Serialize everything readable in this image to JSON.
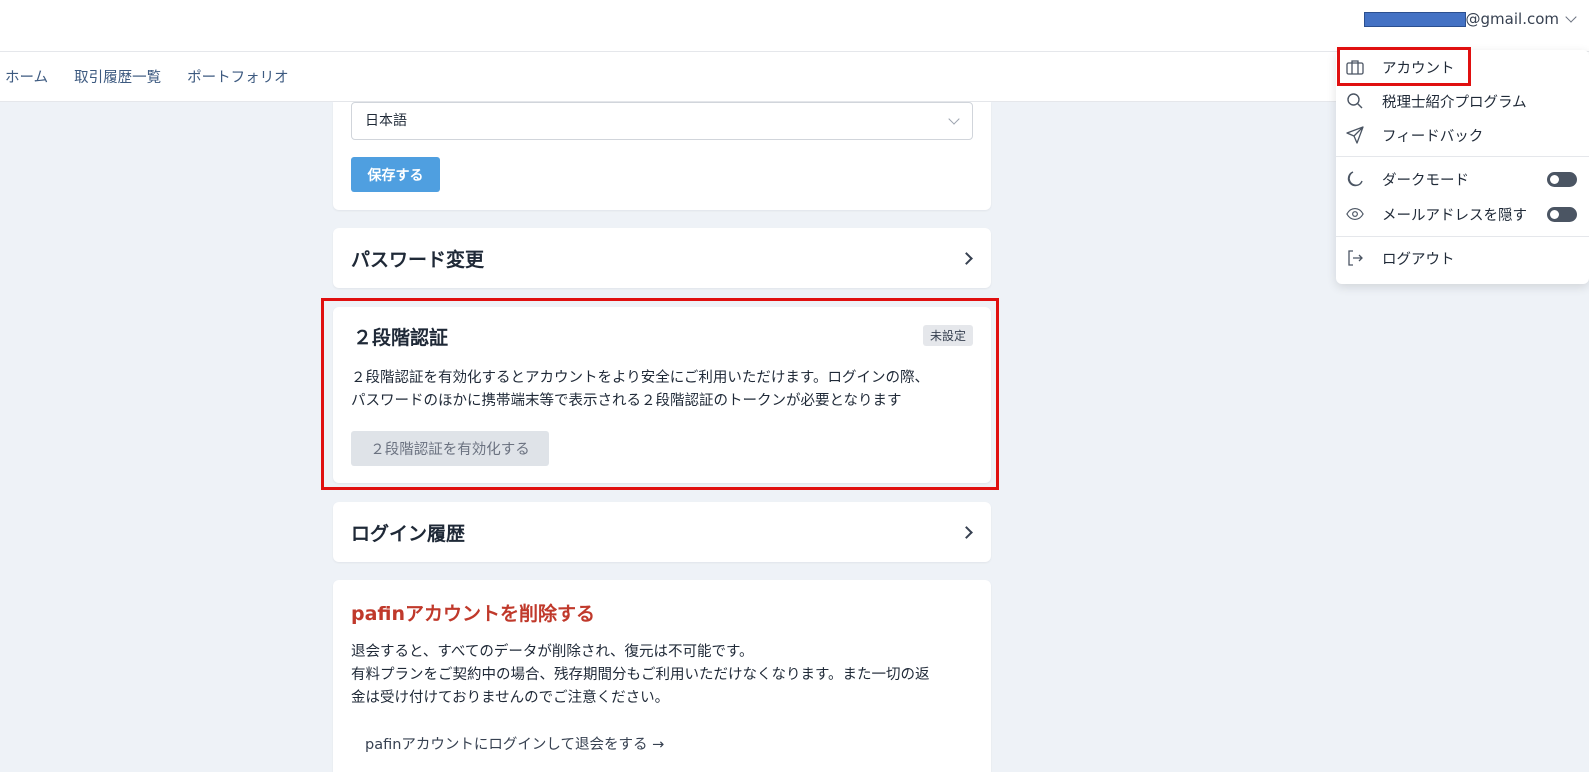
{
  "header": {
    "email_suffix": "@gmail.com"
  },
  "nav": [
    "ホーム",
    "取引履歴一覧",
    "ポートフォリオ"
  ],
  "language": {
    "selected": "日本語",
    "save_label": "保存する"
  },
  "password": {
    "title": "パスワード変更"
  },
  "twofa": {
    "title": "２段階認証",
    "badge": "未設定",
    "desc_line1": "２段階認証を有効化するとアカウントをより安全にご利用いただけます。ログインの際、",
    "desc_line2": "パスワードのほかに携帯端末等で表示される２段階認証のトークンが必要となります",
    "button": "２段階認証を有効化する"
  },
  "login_history": {
    "title": "ログイン履歴"
  },
  "delete": {
    "title": "pafinアカウントを削除する",
    "line1": "退会すると、すべてのデータが削除され、復元は不可能です。",
    "line2": "有料プランをご契約中の場合、残存期間分もご利用いただけなくなります。また一切の返",
    "line3": "金は受け付けておりませんのでご注意ください。",
    "link": "pafinアカウントにログインして退会をする →"
  },
  "menu": {
    "account": "アカウント",
    "referral": "税理士紹介プログラム",
    "feedback": "フィードバック",
    "dark_mode": "ダークモード",
    "hide_email": "メールアドレスを隠す",
    "logout": "ログアウト"
  },
  "icons": {
    "account": "briefcase-icon",
    "referral": "search-icon",
    "feedback": "paper-plane-icon",
    "dark_mode": "moon-icon",
    "hide_email": "eye-icon",
    "logout": "logout-icon"
  },
  "colors": {
    "primary_button": "#4f9fe0",
    "danger_title": "#c0392b",
    "highlight": "#e01010",
    "background": "#eef2f7"
  }
}
